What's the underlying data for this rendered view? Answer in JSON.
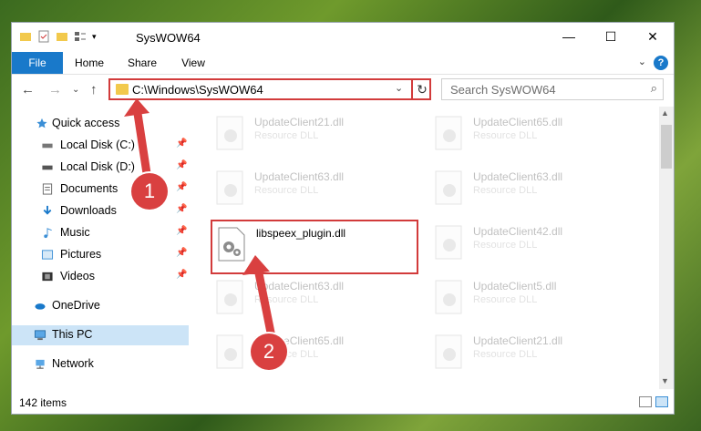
{
  "window": {
    "title": "SysWOW64"
  },
  "caption_buttons": {
    "minimize": "—",
    "maximize": "☐",
    "close": "✕"
  },
  "ribbon": {
    "tabs": [
      {
        "label": "File"
      },
      {
        "label": "Home"
      },
      {
        "label": "Share"
      },
      {
        "label": "View"
      }
    ],
    "help": "?"
  },
  "nav": {
    "back": "←",
    "forward": "→",
    "dropdown": "⌄",
    "up": "↑"
  },
  "address": {
    "path": "C:\\Windows\\SysWOW64",
    "refresh": "↻",
    "dropdown": "⌄"
  },
  "search": {
    "placeholder": "Search SysWOW64",
    "icon": "⌕"
  },
  "sidebar": {
    "items": [
      {
        "label": "Quick access",
        "icon": "star-icon"
      },
      {
        "label": "Local Disk (C:)",
        "icon": "drive-icon",
        "pinned": true
      },
      {
        "label": "Local Disk (D:)",
        "icon": "drive-icon",
        "pinned": true
      },
      {
        "label": "Documents",
        "icon": "document-icon",
        "pinned": true
      },
      {
        "label": "Downloads",
        "icon": "download-icon",
        "pinned": true
      },
      {
        "label": "Music",
        "icon": "music-icon",
        "pinned": true
      },
      {
        "label": "Pictures",
        "icon": "picture-icon",
        "pinned": true
      },
      {
        "label": "Videos",
        "icon": "video-icon",
        "pinned": true
      },
      {
        "label": "OneDrive",
        "icon": "cloud-icon"
      },
      {
        "label": "This PC",
        "icon": "computer-icon",
        "selected": true
      },
      {
        "label": "Network",
        "icon": "network-icon"
      }
    ],
    "pin_glyph": "📌"
  },
  "files": [
    {
      "name": "UpdateClient21.dll",
      "type": "Resource DLL",
      "faded": true
    },
    {
      "name": "UpdateClient65.dll",
      "type": "Resource DLL",
      "faded": true
    },
    {
      "name": "UpdateClient63.dll",
      "type": "Resource DLL",
      "faded": true
    },
    {
      "name": "UpdateClient63.dll",
      "type": "Resource DLL",
      "faded": true
    },
    {
      "name": "libspeex_plugin.dll",
      "type": "",
      "faded": false,
      "highlighted": true
    },
    {
      "name": "UpdateClient42.dll",
      "type": "Resource DLL",
      "faded": true
    },
    {
      "name": "UpdateClient63.dll",
      "type": "Resource DLL",
      "faded": true
    },
    {
      "name": "UpdateClient5.dll",
      "type": "Resource DLL",
      "faded": true
    },
    {
      "name": "UpdateClient65.dll",
      "type": "Resource DLL",
      "faded": true
    },
    {
      "name": "UpdateClient21.dll",
      "type": "Resource DLL",
      "faded": true
    }
  ],
  "status": {
    "count": "142 items"
  },
  "callouts": {
    "one": "1",
    "two": "2"
  },
  "colors": {
    "accent": "#1979ca",
    "highlight": "#d23b3b",
    "selected": "#cce4f7"
  }
}
